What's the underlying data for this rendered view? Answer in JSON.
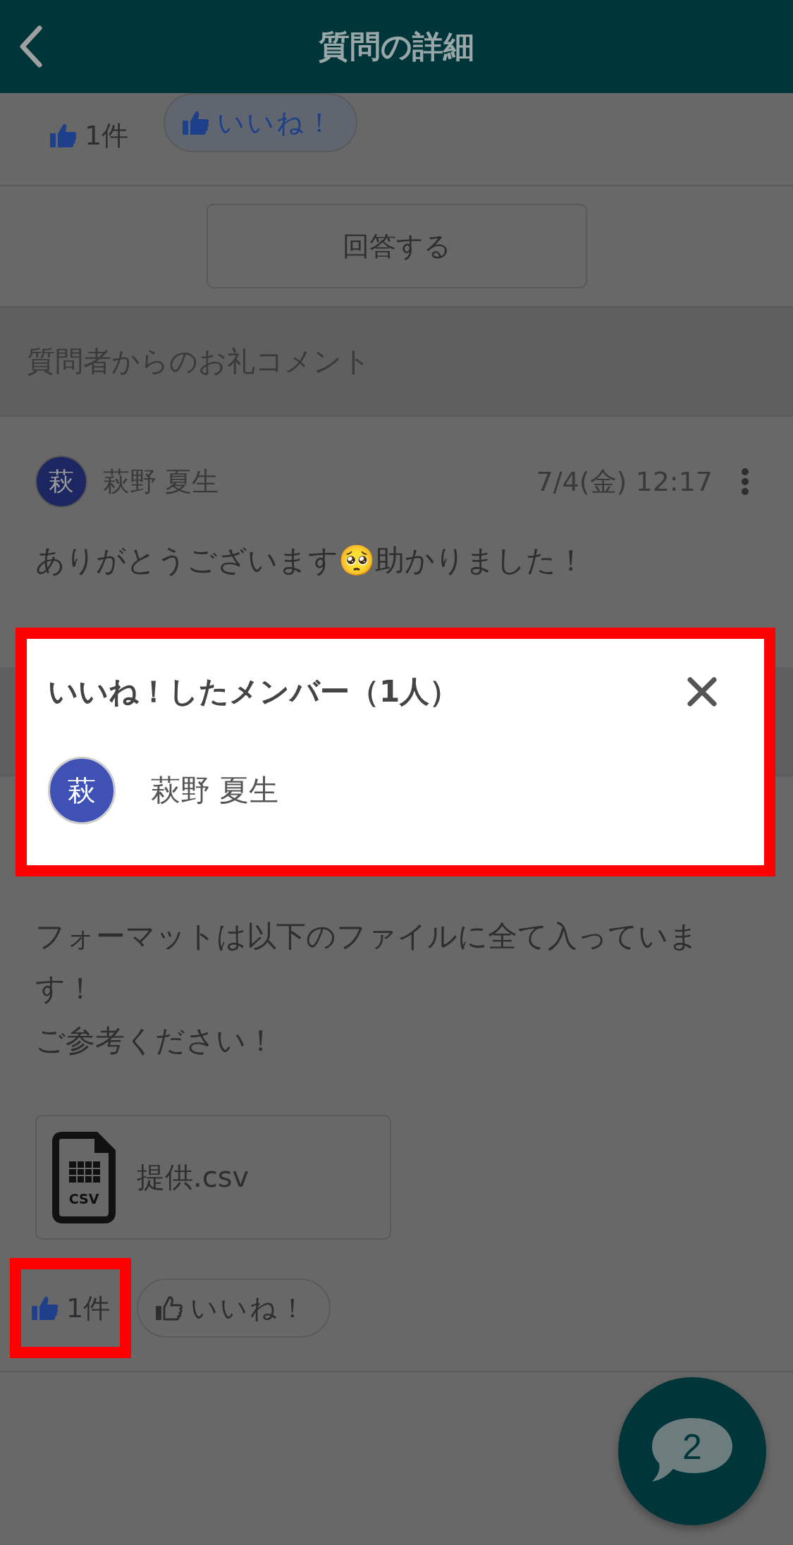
{
  "header": {
    "title": "質問の詳細"
  },
  "question_reactions": {
    "count": "1件",
    "highlighted": false,
    "like_button": {
      "label": "いいね！",
      "selected": true
    }
  },
  "answer_button": "回答する",
  "thanks_section": {
    "title": "質問者からのお礼コメント",
    "comment": {
      "avatar": "萩",
      "author": "萩野 夏生",
      "date": "7/4(金) 12:17",
      "text": "ありがとうございます🥺助かりました！"
    }
  },
  "answer": {
    "text_lines": [
      "フォーマットは以下のファイルに全て入っています！",
      "ご参考ください！"
    ],
    "attachment": {
      "icon_label": "CSV",
      "name": "提供.csv"
    },
    "reactions": {
      "count": "1件",
      "highlighted": true,
      "like_button": {
        "label": "いいね！",
        "selected": false
      }
    }
  },
  "fab": {
    "count": "2"
  },
  "popup": {
    "title": "いいね！したメンバー（1人）",
    "highlighted": true,
    "members": [
      {
        "avatar": "萩",
        "name": "萩野 夏生"
      }
    ]
  }
}
